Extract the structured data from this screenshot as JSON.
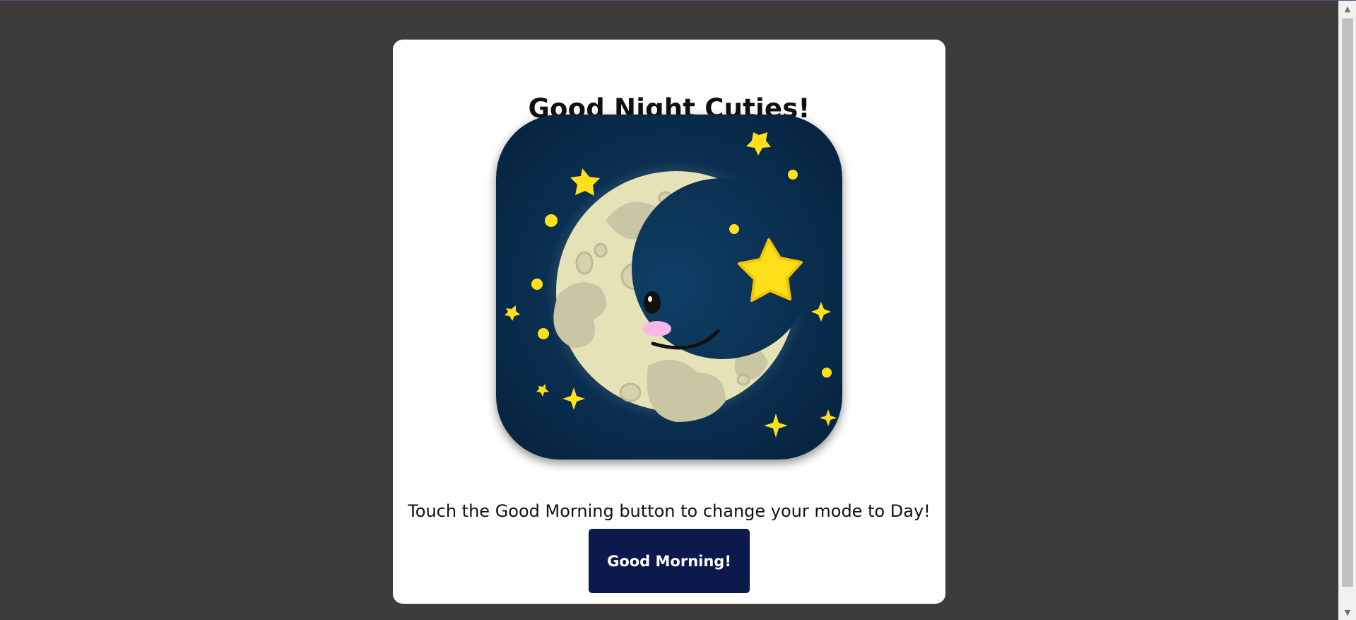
{
  "page": {
    "title": "Good Night Cuties!",
    "description": "Touch the Good Morning button to change your mode to Day!",
    "button_label": "Good Morning!"
  },
  "image": {
    "subject": "smiling crescent moon with stars",
    "icons": [
      "moon-icon",
      "star-icon"
    ]
  },
  "colors": {
    "background": "#3d3c3b",
    "card": "#ffffff",
    "button": "#0b1a4b",
    "night_sky": "#0a2d4d",
    "star": "#ffe01a",
    "moon": "#e6e2b8"
  },
  "scrollbar": {
    "up_glyph": "▲",
    "down_glyph": "▼"
  }
}
